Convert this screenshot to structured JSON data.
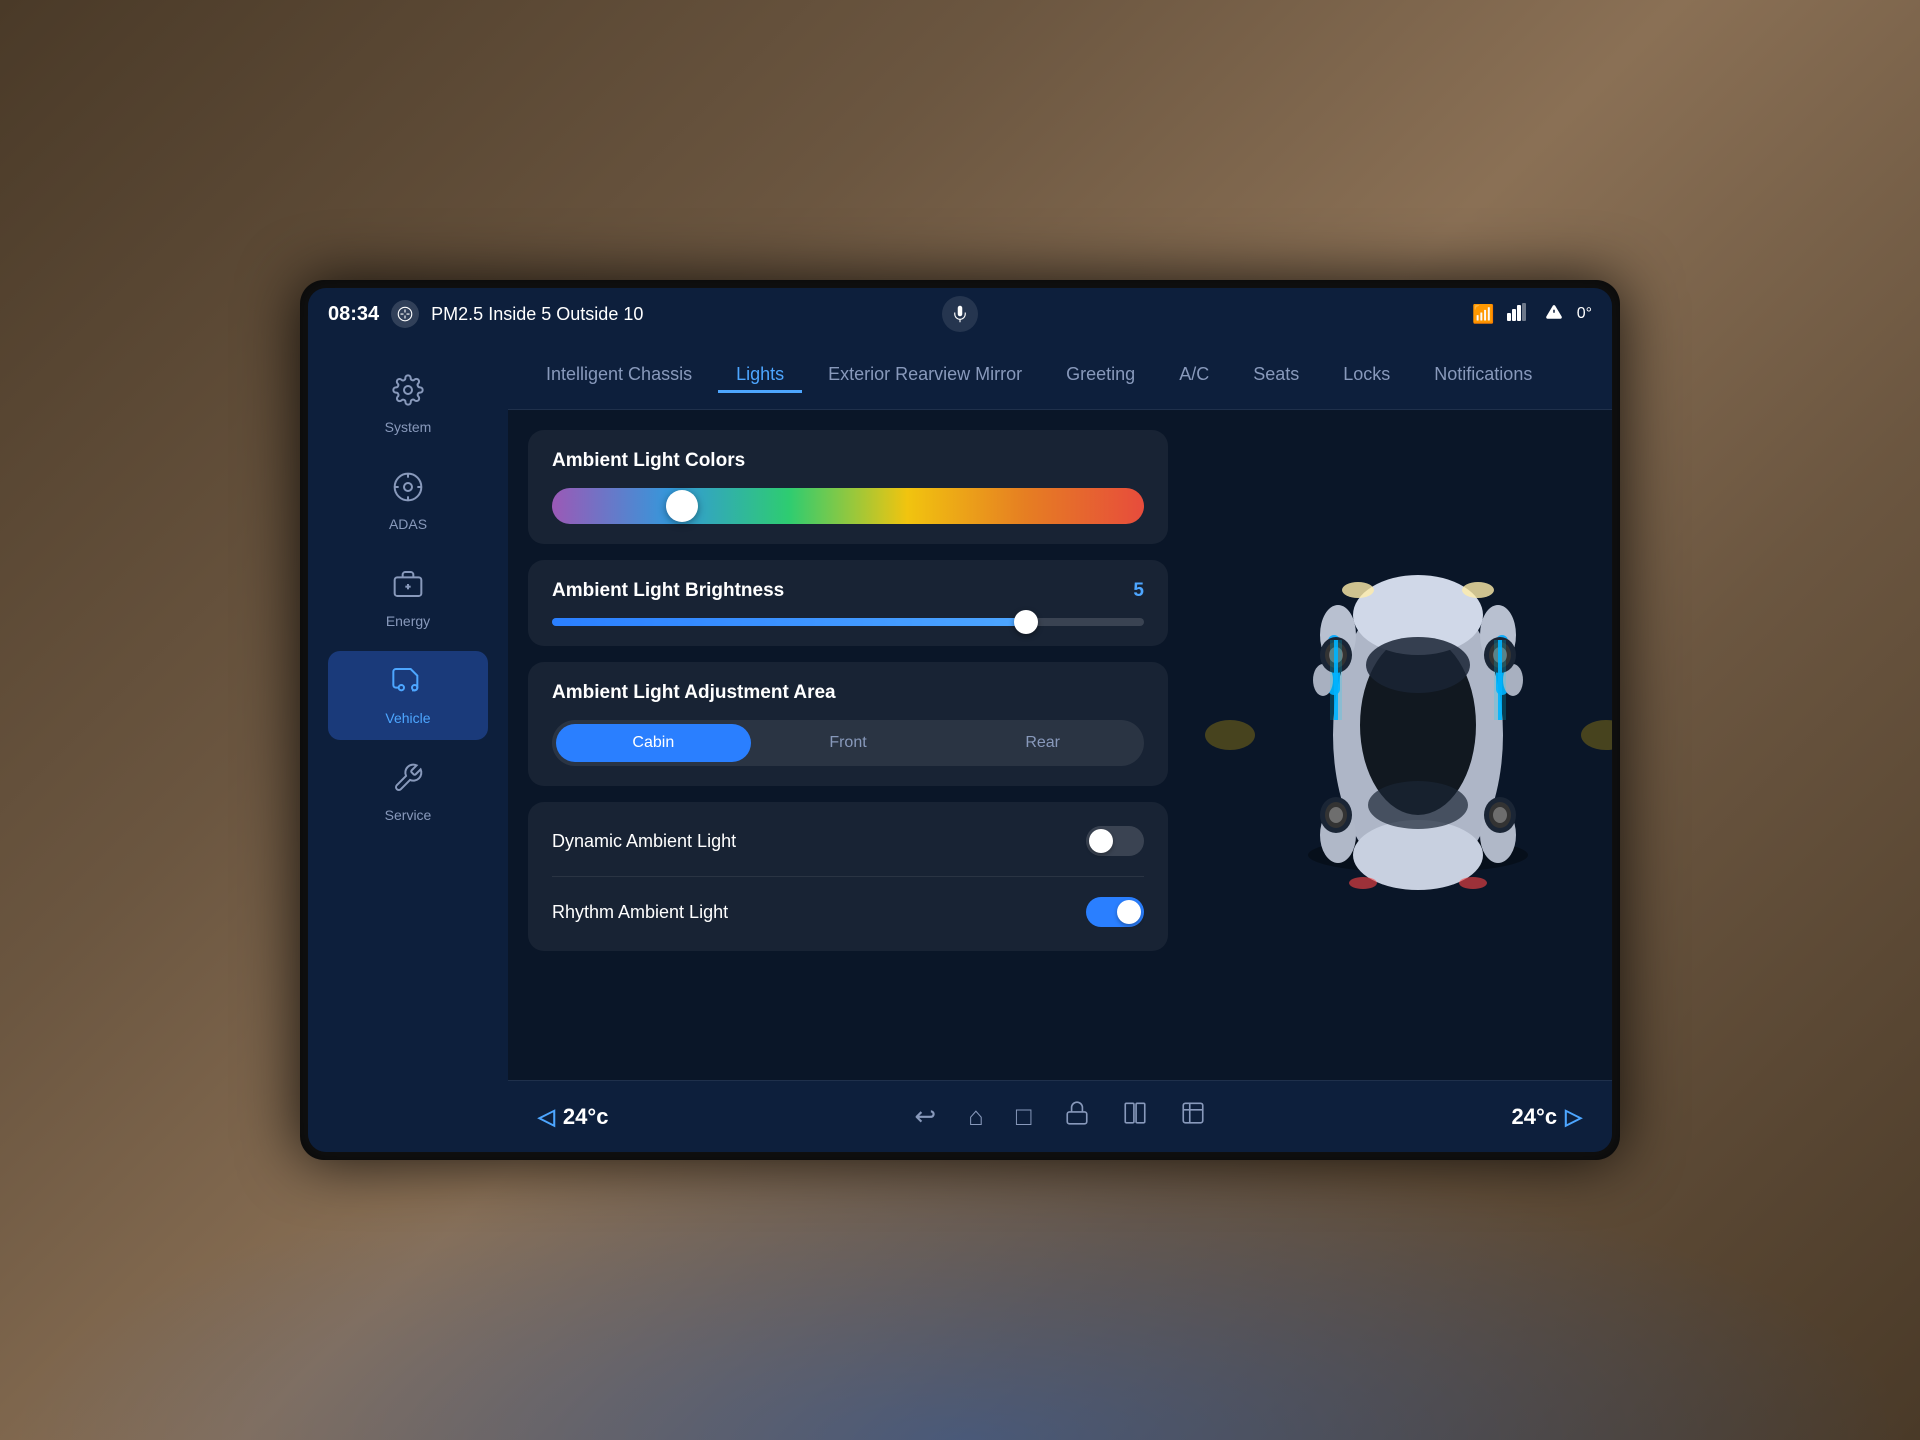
{
  "screen": {
    "status_bar": {
      "time": "08:34",
      "air_quality_label": "PM2.5",
      "inside_label": "Inside",
      "inside_value": "5",
      "outside_label": "Outside",
      "outside_value": "10",
      "signal_icon": "📶",
      "temperature_icon": "🔔",
      "temperature_value": "0°"
    },
    "tabs": [
      {
        "id": "intelligent-chassis",
        "label": "Intelligent Chassis",
        "active": false
      },
      {
        "id": "lights",
        "label": "Lights",
        "active": true
      },
      {
        "id": "exterior-rearview-mirror",
        "label": "Exterior Rearview Mirror",
        "active": false
      },
      {
        "id": "greeting",
        "label": "Greeting",
        "active": false
      },
      {
        "id": "ac",
        "label": "A/C",
        "active": false
      },
      {
        "id": "seats",
        "label": "Seats",
        "active": false
      },
      {
        "id": "locks",
        "label": "Locks",
        "active": false
      },
      {
        "id": "notifications",
        "label": "Notifications",
        "active": false
      }
    ],
    "sidebar": {
      "items": [
        {
          "id": "system",
          "label": "System",
          "icon": "⚙",
          "active": false
        },
        {
          "id": "adas",
          "label": "ADAS",
          "icon": "🎯",
          "active": false
        },
        {
          "id": "energy",
          "label": "Energy",
          "icon": "⚡",
          "active": false
        },
        {
          "id": "vehicle",
          "label": "Vehicle",
          "icon": "🚗",
          "active": true
        },
        {
          "id": "service",
          "label": "Service",
          "icon": "🔧",
          "active": false
        }
      ]
    },
    "lights_settings": {
      "ambient_light_colors": {
        "title": "Ambient Light Colors"
      },
      "ambient_light_brightness": {
        "title": "Ambient Light Brightness",
        "value": "5"
      },
      "ambient_light_adjustment_area": {
        "title": "Ambient Light Adjustment Area",
        "buttons": [
          {
            "id": "cabin",
            "label": "Cabin",
            "active": true
          },
          {
            "id": "front",
            "label": "Front",
            "active": false
          },
          {
            "id": "rear",
            "label": "Rear",
            "active": false
          }
        ]
      },
      "dynamic_ambient_light": {
        "label": "Dynamic Ambient Light",
        "enabled": false
      },
      "rhythm_ambient_light": {
        "label": "Rhythm Ambient Light",
        "enabled": true
      }
    },
    "nav_bar": {
      "temp_left": "24°c",
      "temp_right": "24°c",
      "back_icon": "↩",
      "home_icon": "⌂",
      "recent_icon": "□",
      "lock_icon": "🔒",
      "split_icon": "⊞",
      "cast_icon": "⊡"
    }
  }
}
